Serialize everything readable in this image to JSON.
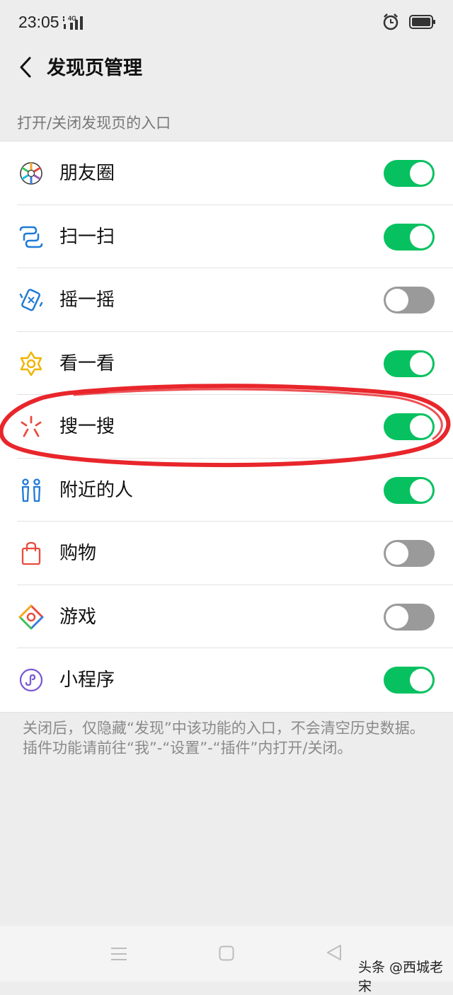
{
  "status": {
    "time": "23:05",
    "network": "4G"
  },
  "header": {
    "title": "发现页管理"
  },
  "section": {
    "title": "打开/关闭发现页的入口"
  },
  "items": [
    {
      "label": "朋友圈",
      "icon": "moments-icon",
      "on": true
    },
    {
      "label": "扫一扫",
      "icon": "scan-icon",
      "on": true
    },
    {
      "label": "摇一摇",
      "icon": "shake-icon",
      "on": false
    },
    {
      "label": "看一看",
      "icon": "top-stories-icon",
      "on": true
    },
    {
      "label": "搜一搜",
      "icon": "search-icon",
      "on": true
    },
    {
      "label": "附近的人",
      "icon": "people-nearby-icon",
      "on": true
    },
    {
      "label": "购物",
      "icon": "shopping-bag-icon",
      "on": false
    },
    {
      "label": "游戏",
      "icon": "games-icon",
      "on": false
    },
    {
      "label": "小程序",
      "icon": "mini-program-icon",
      "on": true
    }
  ],
  "footnote": "关闭后，仅隐藏“发现”中该功能的入口，不会清空历史数据。插件功能请前往“我”-“设置”-“插件”内打开/关闭。",
  "watermark": "头条 @西城老宋",
  "colors": {
    "toggle_on": "#07c160",
    "toggle_off": "#9a9a9a",
    "annotation": "#e8262b",
    "background": "#ededed"
  }
}
